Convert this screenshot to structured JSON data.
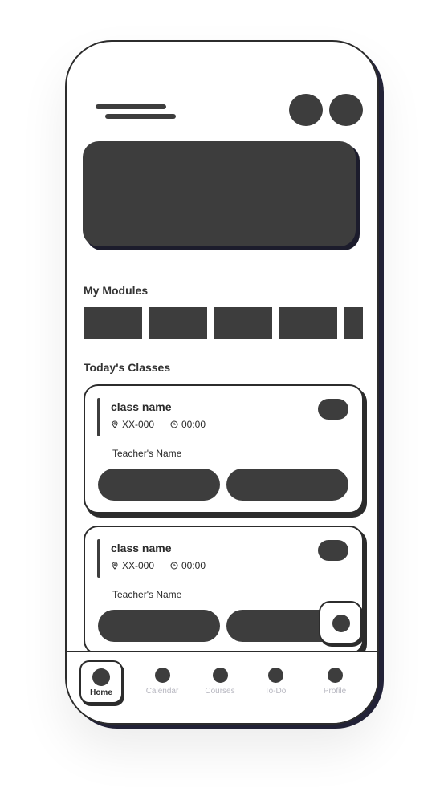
{
  "sections": {
    "modules_title": "My Modules",
    "classes_title": "Today's Classes"
  },
  "classes": [
    {
      "name": "class name",
      "room": "XX-000",
      "time": "00:00",
      "teacher": "Teacher's Name"
    },
    {
      "name": "class name",
      "room": "XX-000",
      "time": "00:00",
      "teacher": "Teacher's Name"
    }
  ],
  "nav": {
    "items": [
      {
        "label": "Home",
        "icon": "home-icon",
        "active": true
      },
      {
        "label": "Calendar",
        "icon": "calendar-icon"
      },
      {
        "label": "Courses",
        "icon": "courses-icon"
      },
      {
        "label": "To-Do",
        "icon": "todo-icon"
      },
      {
        "label": "Profile",
        "icon": "profile-icon"
      }
    ]
  },
  "colors": {
    "fill": "#3d3d3d",
    "outline": "#2c2c2c",
    "inactive_label": "#b7b7c0"
  }
}
